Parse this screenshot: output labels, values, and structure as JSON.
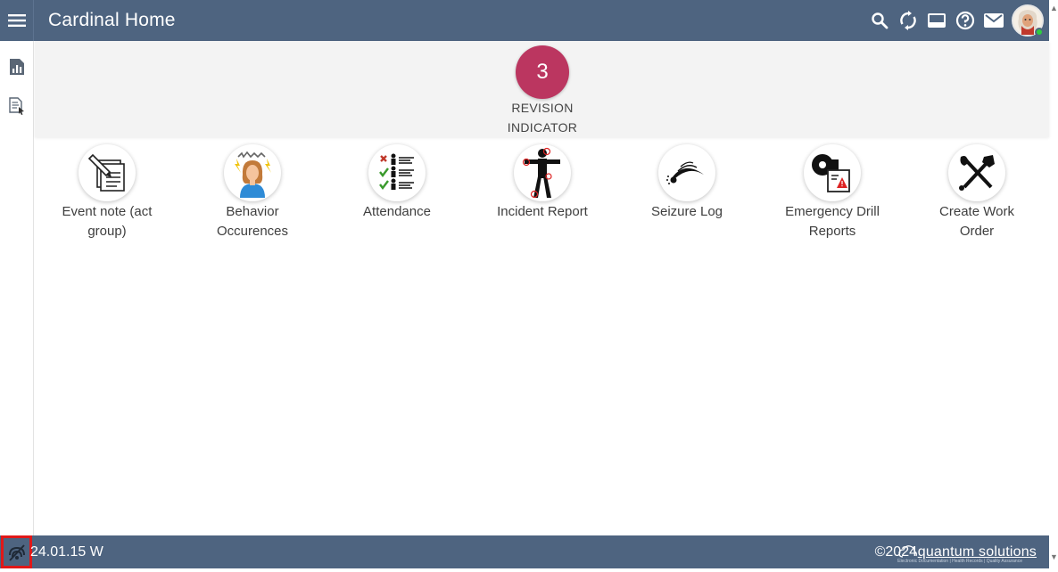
{
  "app": {
    "title": "Cardinal Home"
  },
  "header": {
    "actions": [
      {
        "name": "search-icon"
      },
      {
        "name": "sync-icon"
      },
      {
        "name": "display-icon"
      },
      {
        "name": "help-icon"
      },
      {
        "name": "mail-icon"
      }
    ],
    "status_color": "#2ecc40"
  },
  "sidebar": {
    "items": [
      {
        "icon": "report-chart-icon"
      },
      {
        "icon": "document-pointer-icon"
      }
    ]
  },
  "revision": {
    "count": "3",
    "label_line1": "REVISION",
    "label_line2": "INDICATOR",
    "color": "#bb3660"
  },
  "tiles": [
    {
      "line1": "Event note (act",
      "line2": "group)",
      "icon": "event-note-icon"
    },
    {
      "line1": "Behavior",
      "line2": "Occurences",
      "icon": "behavior-icon"
    },
    {
      "line1": "Attendance",
      "line2": "",
      "icon": "attendance-icon"
    },
    {
      "line1": "Incident Report",
      "line2": "",
      "icon": "incident-report-icon"
    },
    {
      "line1": "Seizure Log",
      "line2": "",
      "icon": "seizure-log-icon"
    },
    {
      "line1": "Emergency Drill",
      "line2": "Reports",
      "icon": "emergency-drill-icon"
    },
    {
      "line1": "Create Work",
      "line2": "Order",
      "icon": "work-order-icon"
    }
  ],
  "footer": {
    "version": "24.01.15 W",
    "copyright": "©2024",
    "brand": "quantum solutions",
    "brand_tagline": "Electronic Documentation | Health Records | Quality Assurance",
    "highlight_color": "#e11818"
  },
  "theme": {
    "header_bg": "#4e6480"
  }
}
